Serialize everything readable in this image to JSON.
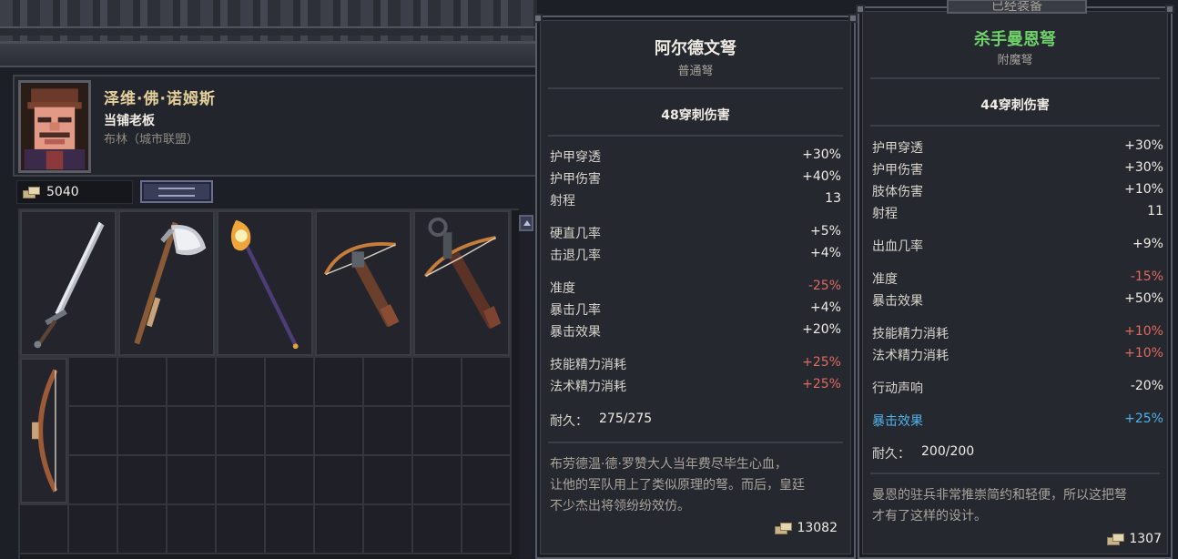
{
  "merchant": {
    "name": "泽维·佛·诺姆斯",
    "role": "当铺老板",
    "location": "布林（城市联盟）",
    "gold": "5040"
  },
  "inventory": {
    "items": [
      {
        "icon": "sword-icon"
      },
      {
        "icon": "axe-icon"
      },
      {
        "icon": "staff-icon"
      },
      {
        "icon": "crossbow-icon"
      },
      {
        "icon": "crossbow-icon"
      },
      {
        "icon": "bow-icon"
      }
    ]
  },
  "tooltip_left": {
    "title": "阿尔德文弩",
    "subtitle": "普通弩",
    "damage": "48穿刺伤害",
    "stats": [
      {
        "k": "护甲穿透",
        "v": "+30%"
      },
      {
        "k": "护甲伤害",
        "v": "+40%"
      },
      {
        "k": "射程",
        "v": "13"
      },
      {
        "k": "硬直几率",
        "v": "+5%"
      },
      {
        "k": "击退几率",
        "v": "+4%"
      },
      {
        "k": "准度",
        "v": "-25%"
      },
      {
        "k": "暴击几率",
        "v": "+4%"
      },
      {
        "k": "暴击效果",
        "v": "+20%"
      },
      {
        "k": "技能精力消耗",
        "v": "+25%"
      },
      {
        "k": "法术精力消耗",
        "v": "+25%"
      }
    ],
    "durability_label": "耐久：",
    "durability": "275/275",
    "lore": [
      "布劳德温·德·罗赞大人当年费尽毕生心血，",
      "让他的军队用上了类似原理的弩。而后，皇廷",
      "不少杰出将领纷纷效仿。"
    ],
    "price": "13082",
    "title_color": "#f0ece4"
  },
  "tooltip_right": {
    "header": "已经装备",
    "title": "杀手曼恩弩",
    "subtitle": "附魔弩",
    "damage": "44穿刺伤害",
    "stats": [
      {
        "k": "护甲穿透",
        "v": "+30%"
      },
      {
        "k": "护甲伤害",
        "v": "+30%"
      },
      {
        "k": "肢体伤害",
        "v": "+10%"
      },
      {
        "k": "射程",
        "v": "11"
      },
      {
        "k": "出血几率",
        "v": "+9%"
      },
      {
        "k": "准度",
        "v": "-15%"
      },
      {
        "k": "暴击效果",
        "v": "+50%"
      },
      {
        "k": "技能精力消耗",
        "v": "+10%"
      },
      {
        "k": "法术精力消耗",
        "v": "+10%"
      },
      {
        "k": "行动声响",
        "v": "-20%"
      },
      {
        "k": "暴击效果",
        "v": "+25%"
      }
    ],
    "durability_label": "耐久：",
    "durability": "200/200",
    "lore": [
      "曼恩的驻兵非常推崇简约和轻便，所以这把弩",
      "才有了这样的设计。"
    ],
    "price": "1307",
    "title_color": "#6fd16a"
  },
  "colors": {
    "negative": "#e06a5e",
    "enchant": "#4fb3e8",
    "gold_text": "#e4cf9b"
  }
}
